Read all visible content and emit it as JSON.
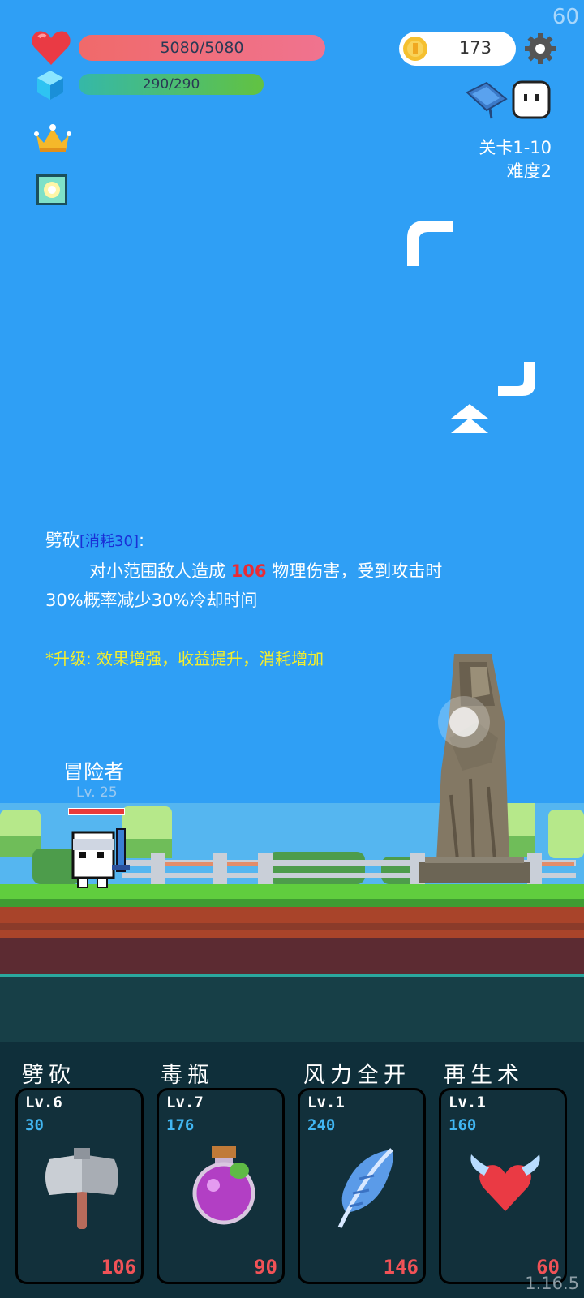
{
  "status": {
    "fps": "60",
    "version": "1.16.5"
  },
  "player": {
    "hp": "5080/5080",
    "mp": "290/290",
    "coins": "173"
  },
  "stage": {
    "level": "关卡1-10",
    "difficulty": "难度2"
  },
  "skill_desc": {
    "name": "劈砍",
    "cost_badge": "消耗30",
    "line1_pre": "对小范围敌人造成",
    "damage": "106",
    "line1_post": "物理伤害，受到攻击时",
    "line2": "30%概率减少30%冷却时间",
    "upgrade": "*升级: 效果增强，收益提升，消耗增加"
  },
  "hero": {
    "name": "冒险者",
    "level": "Lv. 25"
  },
  "skills": [
    {
      "name": "劈砍",
      "level": "Lv.6",
      "cost": "30",
      "value": "106",
      "icon": "axe-icon"
    },
    {
      "name": "毒瓶",
      "level": "Lv.7",
      "cost": "176",
      "value": "90",
      "icon": "poison-bottle-icon"
    },
    {
      "name": "风力全开",
      "level": "Lv.1",
      "cost": "240",
      "value": "146",
      "icon": "feather-icon"
    },
    {
      "name": "再生术",
      "level": "Lv.1",
      "cost": "160",
      "value": "60",
      "icon": "winged-heart-icon"
    }
  ],
  "colors": {
    "sky": "#2f9ff5",
    "hp": "#f06a6a",
    "mp": "#62c241",
    "damage": "#ea2b35",
    "upgrade": "#f5ee2c",
    "panel": "#0f2f3a"
  }
}
